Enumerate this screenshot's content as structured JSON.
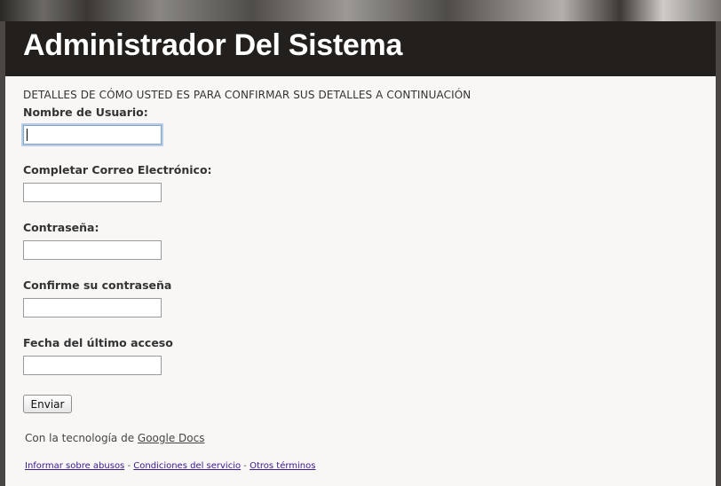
{
  "header": {
    "title": "Administrador Del Sistema"
  },
  "form": {
    "description": "DETALLES DE CÓMO USTED ES PARA CONFIRMAR SUS DETALLES A CONTINUACIÓN",
    "fields": [
      {
        "label": "Nombre de Usuario:",
        "value": ""
      },
      {
        "label": "Completar Correo Electrónico:",
        "value": ""
      },
      {
        "label": "Contraseña:",
        "value": ""
      },
      {
        "label": "Confirme su contraseña",
        "value": ""
      },
      {
        "label": "Fecha del último acceso",
        "value": ""
      }
    ],
    "submit_label": "Enviar"
  },
  "footer": {
    "powered_prefix": "Con la tecnología de",
    "powered_link": "Google Docs",
    "links": [
      "Informar sobre abusos",
      "Condiciones del servicio",
      "Otros términos"
    ],
    "separator": " - "
  }
}
